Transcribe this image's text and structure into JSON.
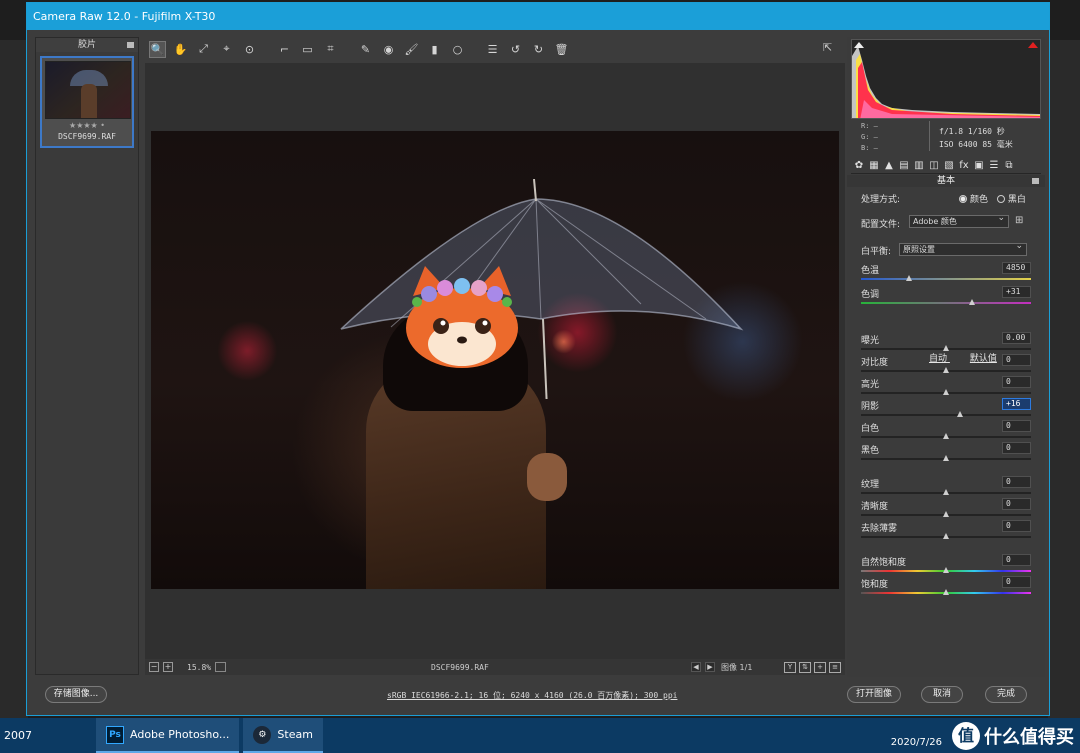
{
  "window": {
    "title": "Camera Raw 12.0 -  Fujifilm X-T30"
  },
  "filmstrip": {
    "header": "胶片",
    "items": [
      {
        "stars": "★★★★ •",
        "filename": "DSCF9699.RAF"
      }
    ]
  },
  "toolbar": {
    "tools": [
      {
        "name": "zoom-tool-icon",
        "glyph": "🔍"
      },
      {
        "name": "hand-tool-icon",
        "glyph": "✋"
      },
      {
        "name": "white-balance-tool-icon",
        "glyph": "⤢"
      },
      {
        "name": "color-sampler-tool-icon",
        "glyph": "⌖"
      },
      {
        "name": "targeted-adjustment-tool-icon",
        "glyph": "⊙"
      },
      {
        "name": "crop-tool-icon",
        "glyph": "⌐"
      },
      {
        "name": "straighten-tool-icon",
        "glyph": "▭"
      },
      {
        "name": "transform-tool-icon",
        "glyph": "⌗"
      },
      {
        "name": "spot-removal-tool-icon",
        "glyph": "✎"
      },
      {
        "name": "red-eye-tool-icon",
        "glyph": "◉"
      },
      {
        "name": "adjustment-brush-icon",
        "glyph": "🖌"
      },
      {
        "name": "graduated-filter-icon",
        "glyph": "▮"
      },
      {
        "name": "radial-filter-icon",
        "glyph": "○"
      },
      {
        "name": "preferences-icon",
        "glyph": "☰"
      },
      {
        "name": "rotate-left-icon",
        "glyph": "↺"
      },
      {
        "name": "rotate-right-icon",
        "glyph": "↻"
      },
      {
        "name": "trash-icon",
        "glyph": "🗑"
      }
    ]
  },
  "canvas_footer": {
    "zoom": "15.8%",
    "filename": "DSCF9699.RAF",
    "image_count": "图像 1/1"
  },
  "exif": {
    "r_label": "R:",
    "g_label": "G:",
    "b_label": "B:",
    "dash": "—",
    "aperture_shutter": "f/1.8  1/160 秒",
    "iso_focal": "ISO 6400  85 毫米"
  },
  "panel": {
    "title": "基本",
    "treatment_label": "处理方式:",
    "treatment_color": "颜色",
    "treatment_bw": "黑白",
    "profile_label": "配置文件:",
    "profile_value": "Adobe 颜色",
    "wb_label": "白平衡:",
    "wb_value": "原照设置",
    "auto": "自动",
    "default": "默认值"
  },
  "sliders": [
    {
      "label": "色温",
      "value": "4850",
      "knob": 0.28,
      "track": "temp"
    },
    {
      "label": "色调",
      "value": "+31",
      "knob": 0.65,
      "track": "tint"
    },
    {
      "label": "曝光",
      "value": "0.00",
      "knob": 0.5
    },
    {
      "label": "对比度",
      "value": "0",
      "knob": 0.5
    },
    {
      "label": "高光",
      "value": "0",
      "knob": 0.5
    },
    {
      "label": "阴影",
      "value": "+16",
      "knob": 0.58,
      "focus": true
    },
    {
      "label": "白色",
      "value": "0",
      "knob": 0.5
    },
    {
      "label": "黑色",
      "value": "0",
      "knob": 0.5
    },
    {
      "label": "纹理",
      "value": "0",
      "knob": 0.5
    },
    {
      "label": "清晰度",
      "value": "0",
      "knob": 0.5
    },
    {
      "label": "去除薄雾",
      "value": "0",
      "knob": 0.5
    },
    {
      "label": "自然饱和度",
      "value": "0",
      "knob": 0.5,
      "track": "vib"
    },
    {
      "label": "饱和度",
      "value": "0",
      "knob": 0.5,
      "track": "sat"
    }
  ],
  "bottom": {
    "save_label": "存储图像...",
    "workflow": "sRGB IEC61966-2.1; 16 位; 6240 x 4160 (26.0 百万像素); 300 ppi",
    "open_label": "打开图像",
    "cancel_label": "取消",
    "done_label": "完成"
  },
  "taskbar": {
    "year": "2007",
    "items": [
      {
        "label": "Adobe Photosho...",
        "icon": "Ps"
      },
      {
        "label": "Steam",
        "icon": "⚙"
      }
    ],
    "date": "2020/7/26",
    "watermark": "什么值得买",
    "watermark_logo": "值"
  }
}
